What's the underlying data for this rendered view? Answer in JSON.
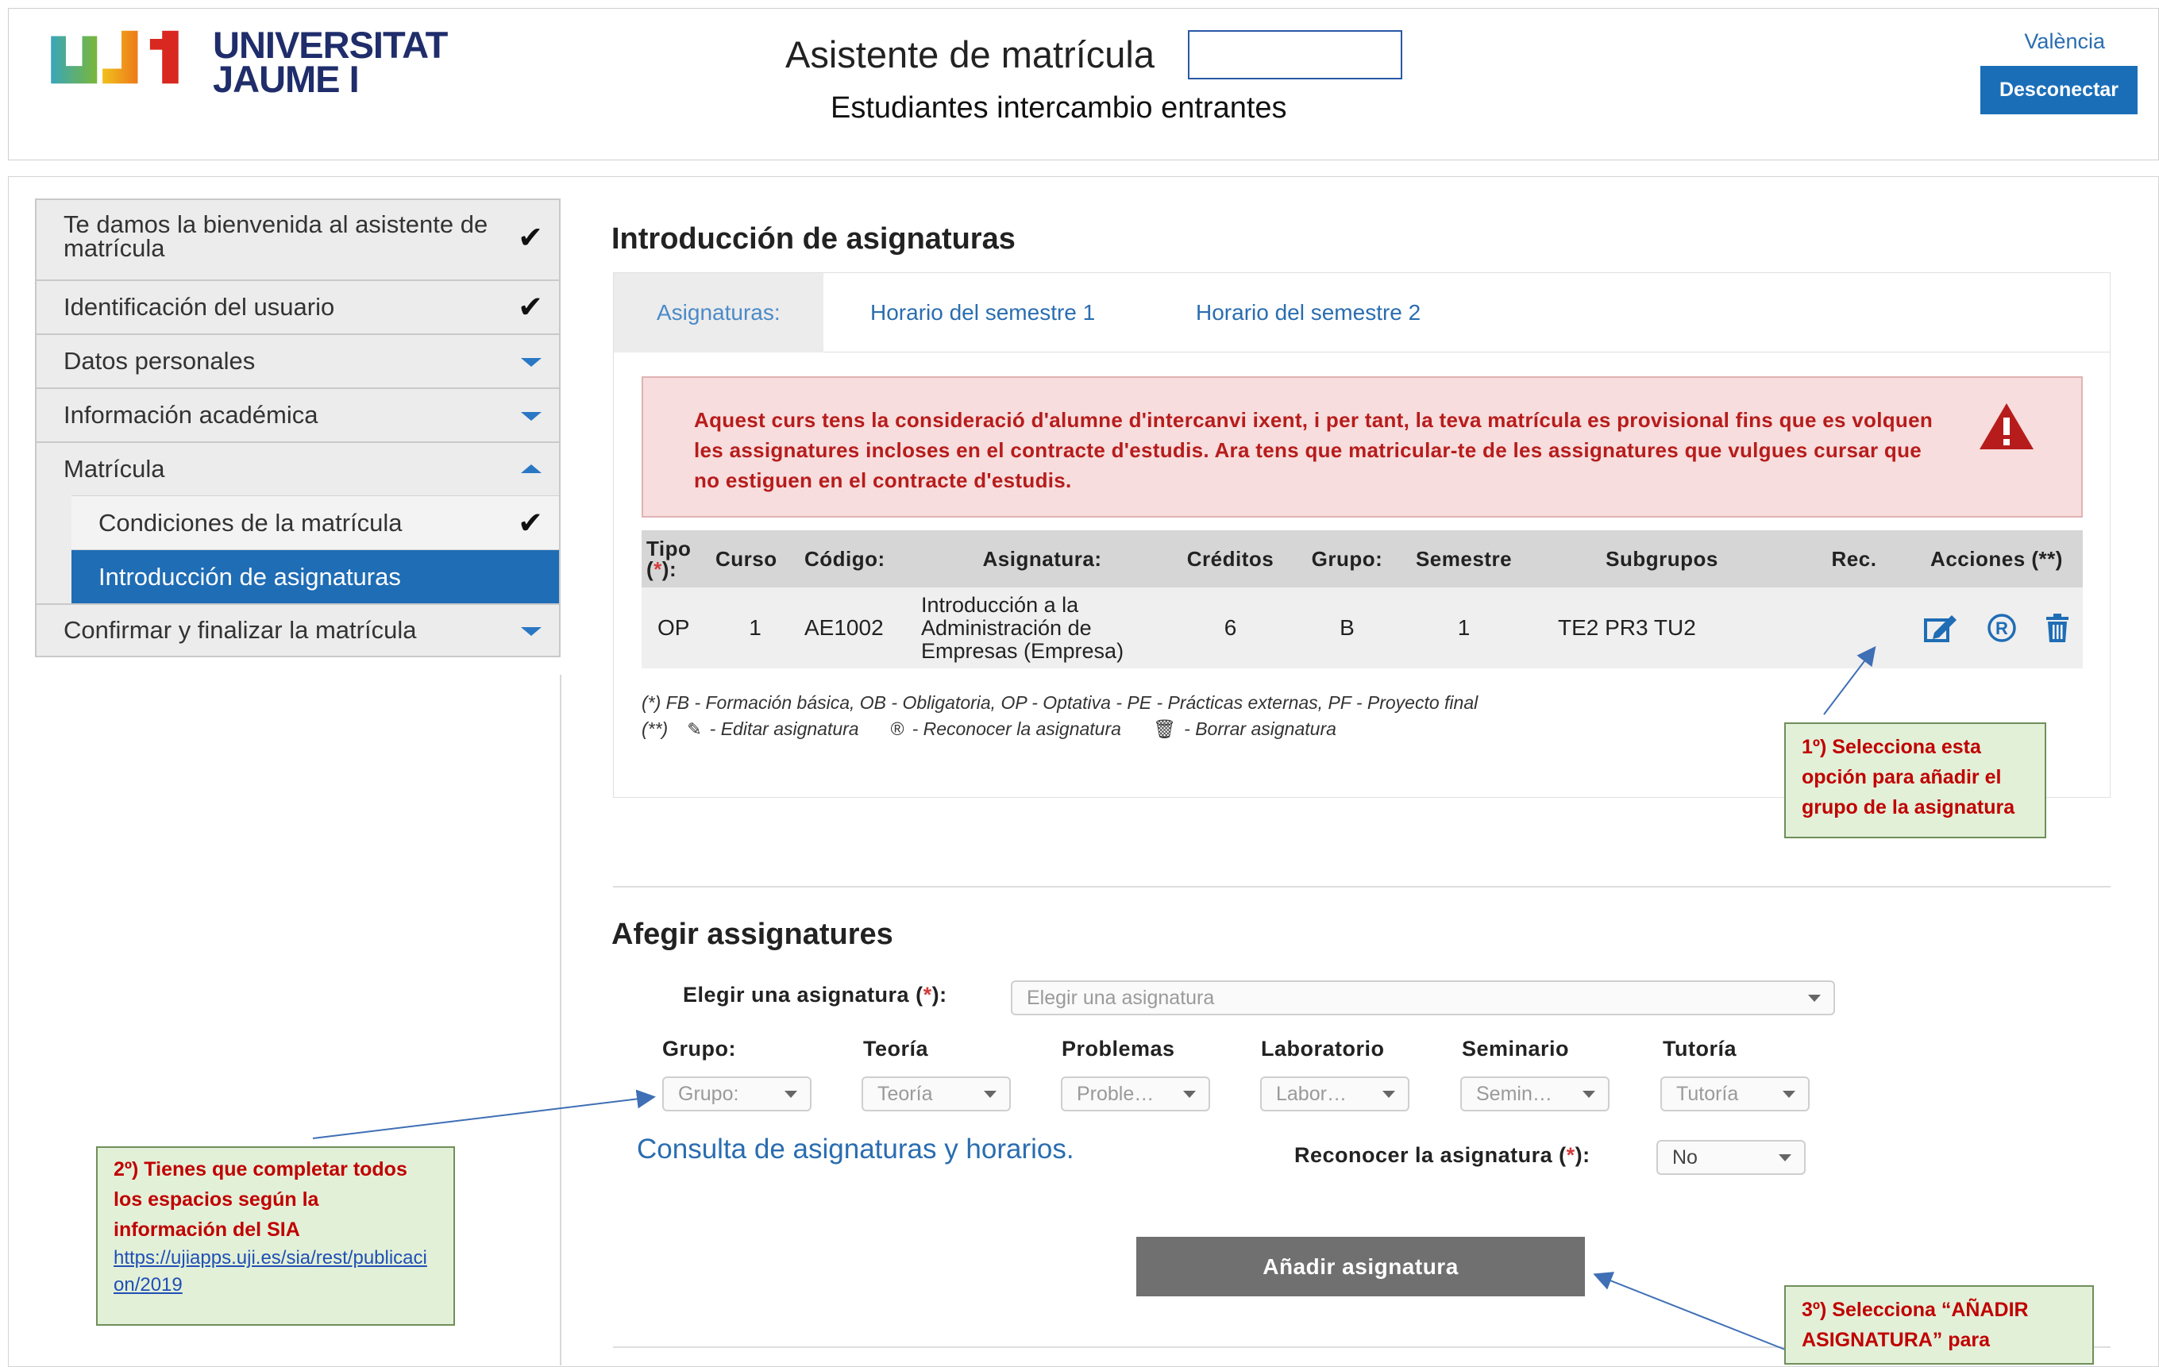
{
  "header": {
    "logo_text_line1": "UNIVERSITAT",
    "logo_text_line2": "JAUME I",
    "title": "Asistente de matrícula",
    "subtitle": "Estudiantes intercambio entrantes",
    "language_link": "València",
    "logout_label": "Desconectar"
  },
  "sidebar": {
    "items": [
      {
        "label": "Te damos la bienvenida al asistente de matrícula",
        "state": "done"
      },
      {
        "label": "Identificación del usuario",
        "state": "done"
      },
      {
        "label": "Datos personales",
        "state": "collapsed"
      },
      {
        "label": "Información académica",
        "state": "collapsed"
      },
      {
        "label": "Matrícula",
        "state": "expanded"
      },
      {
        "label": "Condiciones de la matrícula",
        "state": "done"
      },
      {
        "label": "Introducción de asignaturas",
        "state": "active"
      },
      {
        "label": "Confirmar y finalizar la matrícula",
        "state": "collapsed"
      }
    ]
  },
  "main": {
    "section_title": "Introducción de asignaturas",
    "tabs": [
      {
        "label": "Asignaturas:"
      },
      {
        "label": "Horario del semestre 1"
      },
      {
        "label": "Horario del semestre 2"
      }
    ],
    "alert_text": "Aquest curs tens la consideració d'alumne d'intercanvi ixent, i per tant, la teva matrícula es provisional fins que es volquen les assignatures incloses en el contracte d'estudis. Ara tens que matricular-te de les assignatures que vulgues cursar que no estiguen en el contracte d'estudis.",
    "table": {
      "headers": {
        "tipo": "Tipo",
        "tipo_mark": "(*):",
        "curso": "Curso",
        "codigo": "Código:",
        "asignatura": "Asignatura:",
        "creditos": "Créditos",
        "grupo": "Grupo:",
        "semestre": "Semestre",
        "subgrupos": "Subgrupos",
        "rec": "Rec.",
        "acciones": "Acciones (**)"
      },
      "rows": [
        {
          "tipo": "OP",
          "curso": "1",
          "codigo": "AE1002",
          "asignatura": "Introducción a la Administración de Empresas (Empresa)",
          "creditos": "6",
          "grupo": "B",
          "semestre": "1",
          "subgrupos": "TE2 PR3 TU2",
          "rec": ""
        }
      ]
    },
    "legend_1": "(*)   FB - Formación básica, OB - Obligatoria, OP - Optativa - PE - Prácticas externas, PF - Proyecto final",
    "legend_2_prefix": "(**)",
    "legend_2_edit": "- Editar asignatura",
    "legend_2_recognize": "- Reconocer la asignatura",
    "legend_2_delete": "- Borrar asignatura"
  },
  "add_section": {
    "title": "Afegir assignatures",
    "choose_label": "Elegir una asignatura (*):",
    "choose_placeholder": "Elegir una asignatura",
    "fields": [
      {
        "label": "Grupo:",
        "placeholder": "Grupo:"
      },
      {
        "label": "Teoría",
        "placeholder": "Teoría"
      },
      {
        "label": "Problemas",
        "placeholder": "Proble…"
      },
      {
        "label": "Laboratorio",
        "placeholder": "Labor…"
      },
      {
        "label": "Seminario",
        "placeholder": "Semin…"
      },
      {
        "label": "Tutoría",
        "placeholder": "Tutoría"
      }
    ],
    "consult_link": "Consulta de asignaturas y horarios.",
    "recognize_label": "Reconocer la asignatura (*):",
    "recognize_value": "No",
    "add_button": "Añadir asignatura"
  },
  "annotations": {
    "note1": "1º) Selecciona esta opción para añadir el grupo de la asignatura",
    "note2": "2º) Tienes que completar todos los espacios según la información del SIA",
    "note2_link": "https://ujiapps.uji.es/sia/rest/publicacion/2019",
    "note3": "3º) Selecciona “AÑADIR ASIGNATURA” para"
  },
  "colors": {
    "accent_blue": "#1f6db5",
    "alert_bg": "#f7dddd",
    "alert_text": "#b71c1c",
    "note_bg": "#e3f0d8",
    "note_text": "#c00000"
  }
}
